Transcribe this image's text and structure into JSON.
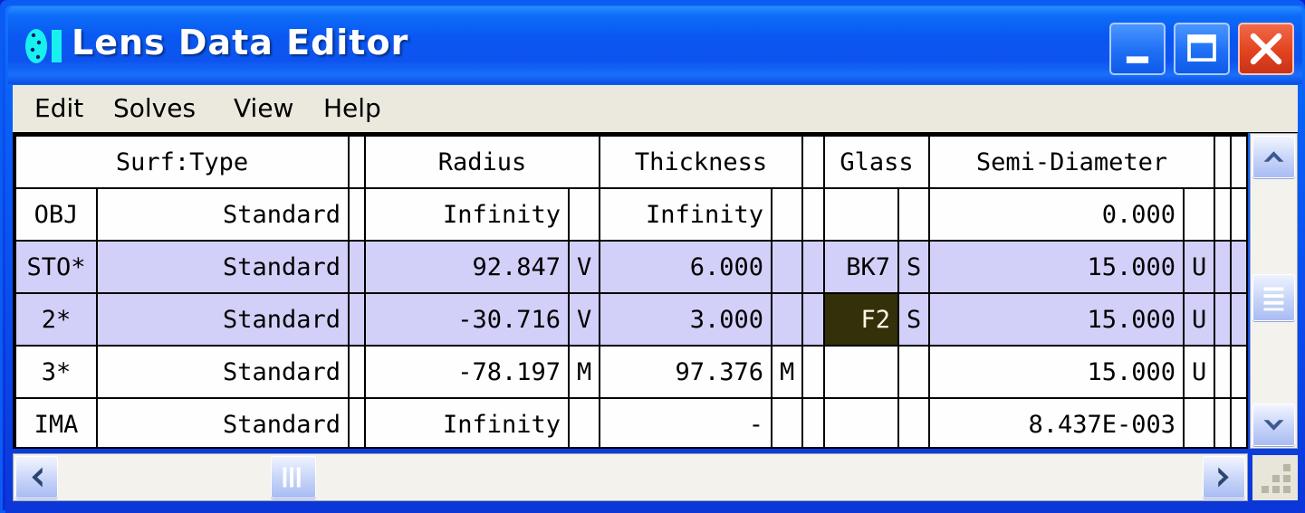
{
  "window": {
    "title": "Lens Data Editor",
    "icon": "lens-icon",
    "accent_title_blue": "#0a57f2",
    "selection_color": "#d2d0f8",
    "active_cell_color": "#33300a",
    "controls": {
      "minimize": "minimize-icon",
      "maximize": "maximize-icon",
      "close": "close-icon"
    }
  },
  "menubar": {
    "items": [
      {
        "label": "Edit"
      },
      {
        "label": "Solves"
      },
      {
        "label": "View"
      },
      {
        "label": "Help"
      }
    ]
  },
  "grid": {
    "headers": [
      "Surf:Type",
      "Radius",
      "Thickness",
      "Glass",
      "Semi-Diameter"
    ],
    "rows": [
      {
        "surf": "OBJ",
        "type": "Standard",
        "radius": "Infinity",
        "radius_flag": "",
        "thickness": "Infinity",
        "thickness_flag": "",
        "glass": "",
        "glass_flag": "",
        "semi": "0.000",
        "semi_flag": "",
        "selected": false,
        "active_cell": ""
      },
      {
        "surf": "STO*",
        "type": "Standard",
        "radius": "92.847",
        "radius_flag": "V",
        "thickness": "6.000",
        "thickness_flag": "",
        "glass": "BK7",
        "glass_flag": "S",
        "semi": "15.000",
        "semi_flag": "U",
        "selected": true,
        "active_cell": ""
      },
      {
        "surf": "2*",
        "type": "Standard",
        "radius": "-30.716",
        "radius_flag": "V",
        "thickness": "3.000",
        "thickness_flag": "",
        "glass": "F2",
        "glass_flag": "S",
        "semi": "15.000",
        "semi_flag": "U",
        "selected": true,
        "active_cell": "glass"
      },
      {
        "surf": "3*",
        "type": "Standard",
        "radius": "-78.197",
        "radius_flag": "M",
        "thickness": "97.376",
        "thickness_flag": "M",
        "glass": "",
        "glass_flag": "",
        "semi": "15.000",
        "semi_flag": "U",
        "selected": false,
        "active_cell": ""
      },
      {
        "surf": "IMA",
        "type": "Standard",
        "radius": "Infinity",
        "radius_flag": "",
        "thickness": "-",
        "thickness_flag": "",
        "glass": "",
        "glass_flag": "",
        "semi": "8.437E-003",
        "semi_flag": "",
        "selected": false,
        "active_cell": ""
      }
    ]
  },
  "scrollbars": {
    "vertical": {
      "up": "scroll-up-icon",
      "down": "scroll-down-icon",
      "thumb": "scroll-thumb"
    },
    "horizontal": {
      "left": "scroll-left-icon",
      "right": "scroll-right-icon",
      "thumb": "scroll-thumb"
    },
    "resize_grip": "resize-grip-icon"
  }
}
